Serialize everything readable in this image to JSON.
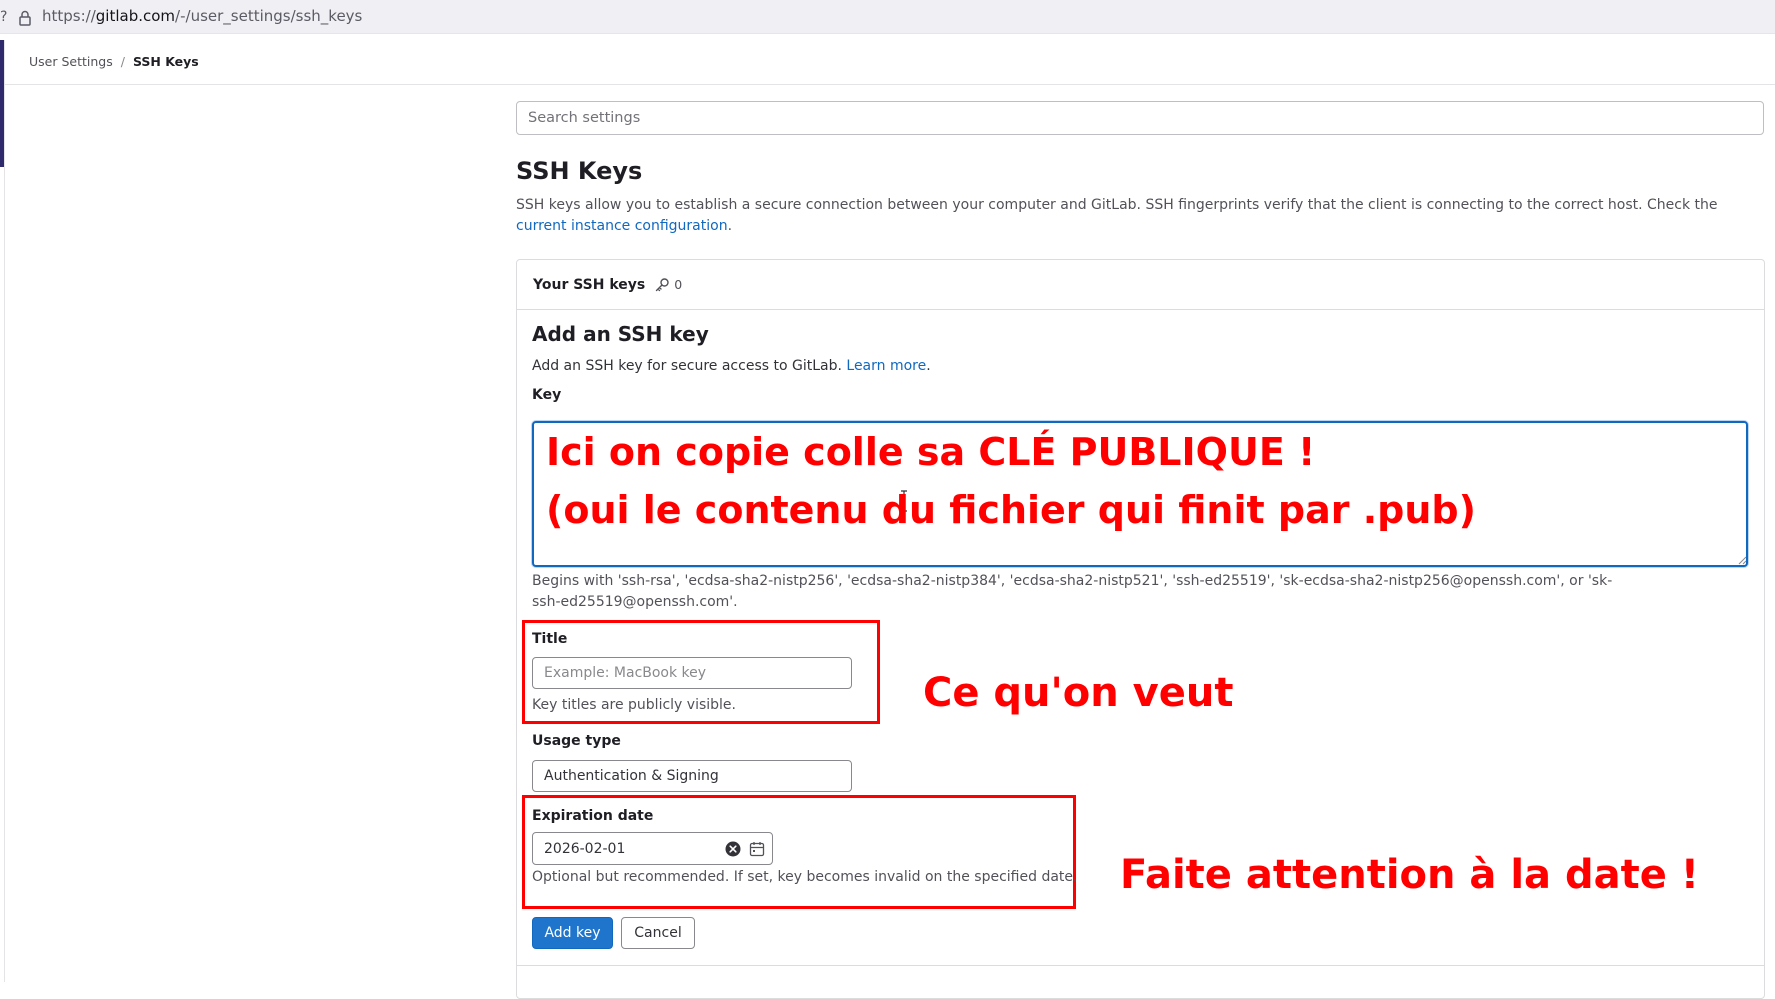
{
  "browser": {
    "url_prefix": "https://",
    "url_host": "gitlab.com",
    "url_path": "/-/user_settings/ssh_keys"
  },
  "breadcrumb": {
    "parent": "User Settings",
    "separator": "/",
    "current": "SSH Keys"
  },
  "search": {
    "placeholder": "Search settings"
  },
  "page": {
    "title": "SSH Keys",
    "description": "SSH keys allow you to establish a secure connection between your computer and GitLab. SSH fingerprints verify that the client is connecting to the correct host. Check the ",
    "description_link": "current instance configuration",
    "description_end": "."
  },
  "card": {
    "header_title": "Your SSH keys",
    "key_count": "0"
  },
  "form": {
    "title": "Add an SSH key",
    "description": "Add an SSH key for secure access to GitLab. ",
    "learn_more": "Learn more",
    "description_end": ".",
    "key_label": "Key",
    "key_help": "Begins with 'ssh-rsa', 'ecdsa-sha2-nistp256', 'ecdsa-sha2-nistp384', 'ecdsa-sha2-nistp521', 'ssh-ed25519', 'sk-ecdsa-sha2-nistp256@openssh.com', or 'sk-ssh-ed25519@openssh.com'.",
    "title_label": "Title",
    "title_placeholder": "Example: MacBook key",
    "title_help": "Key titles are publicly visible.",
    "usage_label": "Usage type",
    "usage_value": "Authentication & Signing",
    "expiration_label": "Expiration date",
    "expiration_value": "2026-02-01",
    "expiration_help": "Optional but recommended. If set, key becomes invalid on the specified date.",
    "submit_label": "Add key",
    "cancel_label": "Cancel"
  },
  "annotations": {
    "key_line_1": "Ici on copie colle sa CLÉ PUBLIQUE !",
    "key_line_2": "(oui le contenu du fichier qui finit par .pub)",
    "title_note": "Ce qu'on veut",
    "date_note": "Faite attention à la date !"
  },
  "colors": {
    "annotation": "#ff0000",
    "link": "#1068bf",
    "primary_button": "#1f75cb",
    "sidebar_accent": "#2f2a6b"
  },
  "icons": {
    "lock": "lock-icon",
    "key": "key-icon",
    "clear": "clear-icon",
    "calendar": "calendar-icon"
  }
}
